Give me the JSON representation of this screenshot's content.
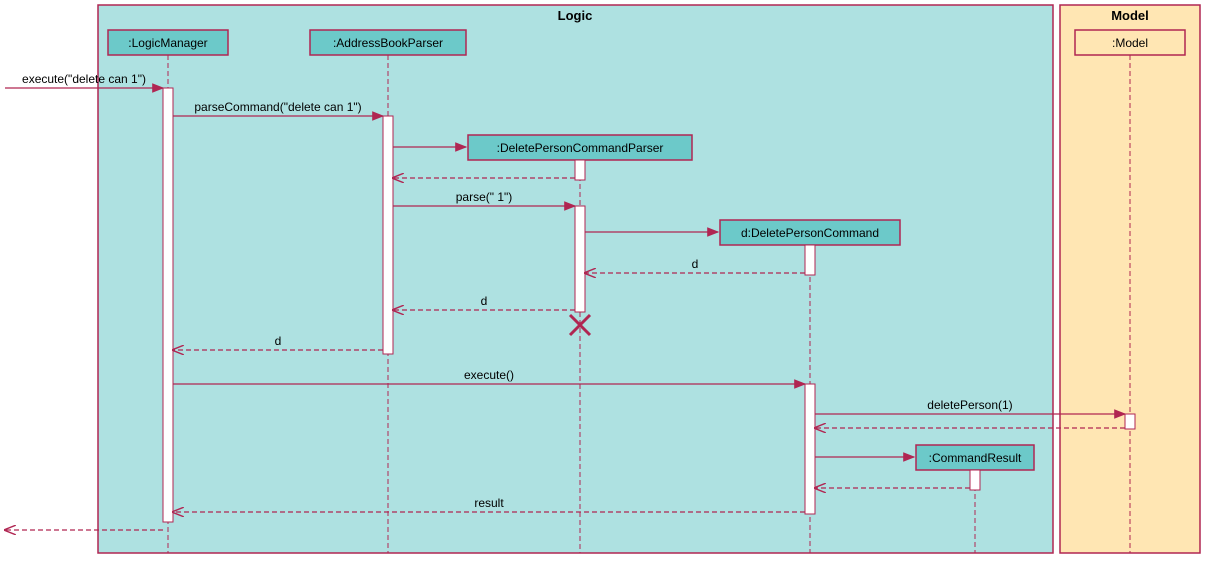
{
  "frames": {
    "logic": {
      "title": "Logic"
    },
    "model": {
      "title": "Model"
    }
  },
  "participants": {
    "logicManager": ":LogicManager",
    "addressBookParser": ":AddressBookParser",
    "deletePersonCommandParser": ":DeletePersonCommandParser",
    "deletePersonCommand": "d:DeletePersonCommand",
    "commandResult": ":CommandResult",
    "model": ":Model"
  },
  "messages": {
    "m1": "execute(\"delete can 1\")",
    "m2": "parseCommand(\"delete can 1\")",
    "m3": "parse(\" 1\")",
    "m4": "d",
    "m5": "d",
    "m6": "d",
    "m7": "execute()",
    "m8": "deletePerson(1)",
    "m9": "result"
  },
  "colors": {
    "logicBg": "#aee1e1",
    "modelBg": "#ffe6b3",
    "participantBg": "#6cc9c9",
    "modelParticipantBg": "#ffe6b3",
    "stroke": "#b02652",
    "activation": "#ffffff"
  },
  "chart_data": {
    "type": "sequence-diagram",
    "frames": [
      {
        "name": "Logic",
        "participants": [
          "LogicManager",
          "AddressBookParser",
          "DeletePersonCommandParser",
          "DeletePersonCommand",
          "CommandResult"
        ]
      },
      {
        "name": "Model",
        "participants": [
          "Model"
        ]
      }
    ],
    "participants": [
      {
        "id": "LogicManager",
        "label": ":LogicManager"
      },
      {
        "id": "AddressBookParser",
        "label": ":AddressBookParser"
      },
      {
        "id": "DeletePersonCommandParser",
        "label": ":DeletePersonCommandParser",
        "createdAt": 2
      },
      {
        "id": "DeletePersonCommand",
        "label": "d:DeletePersonCommand",
        "createdAt": 4
      },
      {
        "id": "CommandResult",
        "label": ":CommandResult",
        "createdAt": 10
      },
      {
        "id": "Model",
        "label": ":Model"
      }
    ],
    "messages": [
      {
        "from": "external",
        "to": "LogicManager",
        "label": "execute(\"delete can 1\")",
        "type": "call"
      },
      {
        "from": "LogicManager",
        "to": "AddressBookParser",
        "label": "parseCommand(\"delete can 1\")",
        "type": "call"
      },
      {
        "from": "AddressBookParser",
        "to": "DeletePersonCommandParser",
        "label": "",
        "type": "create"
      },
      {
        "from": "DeletePersonCommandParser",
        "to": "AddressBookParser",
        "label": "",
        "type": "return"
      },
      {
        "from": "AddressBookParser",
        "to": "DeletePersonCommandParser",
        "label": "parse(\" 1\")",
        "type": "call"
      },
      {
        "from": "DeletePersonCommandParser",
        "to": "DeletePersonCommand",
        "label": "",
        "type": "create"
      },
      {
        "from": "DeletePersonCommand",
        "to": "DeletePersonCommandParser",
        "label": "d",
        "type": "return"
      },
      {
        "from": "DeletePersonCommandParser",
        "to": "AddressBookParser",
        "label": "d",
        "type": "return"
      },
      {
        "from": "DeletePersonCommandParser",
        "to": null,
        "label": "",
        "type": "destroy"
      },
      {
        "from": "AddressBookParser",
        "to": "LogicManager",
        "label": "d",
        "type": "return"
      },
      {
        "from": "LogicManager",
        "to": "DeletePersonCommand",
        "label": "execute()",
        "type": "call"
      },
      {
        "from": "DeletePersonCommand",
        "to": "Model",
        "label": "deletePerson(1)",
        "type": "call"
      },
      {
        "from": "Model",
        "to": "DeletePersonCommand",
        "label": "",
        "type": "return"
      },
      {
        "from": "DeletePersonCommand",
        "to": "CommandResult",
        "label": "",
        "type": "create"
      },
      {
        "from": "CommandResult",
        "to": "DeletePersonCommand",
        "label": "",
        "type": "return"
      },
      {
        "from": "DeletePersonCommand",
        "to": "LogicManager",
        "label": "result",
        "type": "return"
      },
      {
        "from": "LogicManager",
        "to": "external",
        "label": "",
        "type": "return"
      }
    ]
  }
}
